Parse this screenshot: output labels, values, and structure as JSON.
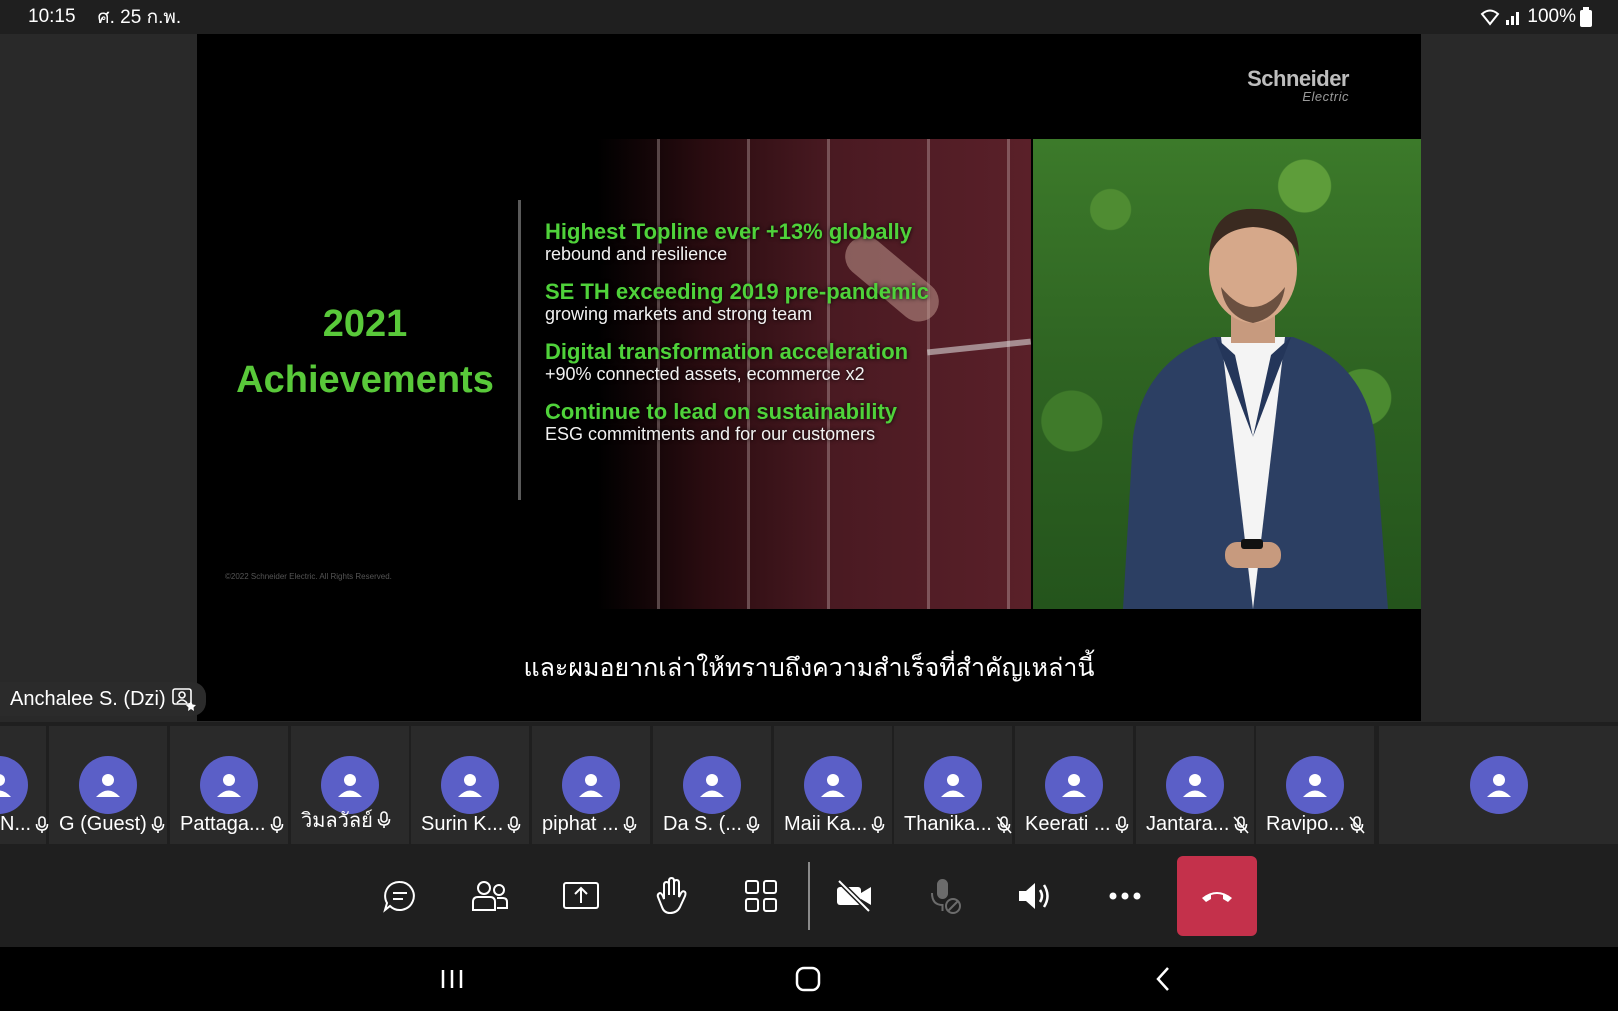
{
  "status_bar": {
    "time": "10:15",
    "date": "ศ. 25 ก.พ.",
    "battery": "100%"
  },
  "presentation": {
    "logo_name": "Schneider",
    "logo_sub": "Electric",
    "slide_title_year": "2021",
    "slide_title_word": "Achievements",
    "bullets": [
      {
        "headline": "Highest Topline ever +13% globally",
        "detail": "rebound and resilience"
      },
      {
        "headline": "SE TH exceeding 2019 pre-pandemic",
        "detail": "growing markets and strong team"
      },
      {
        "headline": "Digital transformation acceleration",
        "detail": "+90% connected assets, ecommerce x2"
      },
      {
        "headline": "Continue to lead on sustainability",
        "detail": "ESG commitments and for our customers"
      }
    ],
    "copyright": "©2022 Schneider Electric. All Rights Reserved.",
    "caption": "และผมอยากเล่าให้ทราบถึงความสำเร็จที่สำคัญเหล่านี้",
    "presenter_name": "Anchalee S. (Dzi)"
  },
  "participants": [
    {
      "name": "N...",
      "mic": "on"
    },
    {
      "name": "G (Guest)",
      "mic": "on"
    },
    {
      "name": "Pattaga...",
      "mic": "on"
    },
    {
      "name": "วิมลวัลย์",
      "mic": "on"
    },
    {
      "name": "Surin K...",
      "mic": "on"
    },
    {
      "name": "piphat ...",
      "mic": "on"
    },
    {
      "name": "Da S. (...",
      "mic": "on"
    },
    {
      "name": "Maii Ka...",
      "mic": "on"
    },
    {
      "name": "Thanika...",
      "mic": "muted"
    },
    {
      "name": "Keerati ...",
      "mic": "on"
    },
    {
      "name": "Jantara...",
      "mic": "muted"
    },
    {
      "name": "Ravipo...",
      "mic": "muted"
    }
  ],
  "controls": [
    {
      "id": "chat",
      "icon": "chat-icon"
    },
    {
      "id": "people",
      "icon": "people-icon"
    },
    {
      "id": "share",
      "icon": "share-screen-icon"
    },
    {
      "id": "raise-hand",
      "icon": "hand-icon"
    },
    {
      "id": "view",
      "icon": "grid-view-icon"
    },
    {
      "id": "camera",
      "icon": "camera-off-icon"
    },
    {
      "id": "mic",
      "icon": "mic-disabled-icon"
    },
    {
      "id": "speaker",
      "icon": "speaker-icon"
    },
    {
      "id": "more",
      "icon": "more-icon"
    },
    {
      "id": "leave",
      "icon": "hang-up-icon"
    }
  ],
  "colors": {
    "accent_green": "#4fd23a",
    "avatar_purple": "#5b5fc7",
    "hangup_red": "#c4314b",
    "background": "#1f1f1f"
  }
}
